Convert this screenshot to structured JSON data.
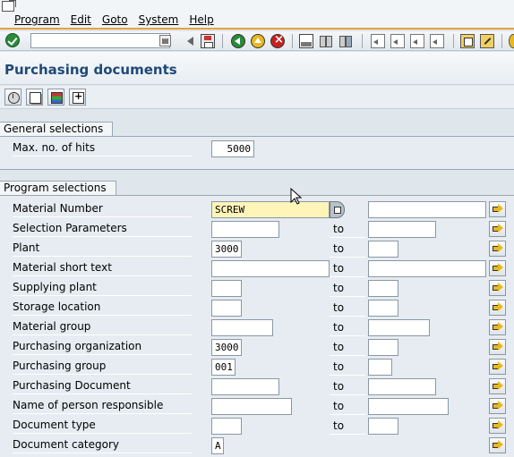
{
  "menubar": {
    "items": [
      "Program",
      "Edit",
      "Goto",
      "System",
      "Help"
    ]
  },
  "toolbar": {
    "command_field_value": "",
    "icons": [
      "ok-icon",
      "back-arrow-icon",
      "save-icon",
      "back-icon",
      "exit-icon",
      "cancel-icon",
      "print-icon",
      "find-icon",
      "find-next-icon",
      "first-page-icon",
      "previous-page-icon",
      "next-page-icon",
      "last-page-icon",
      "new-session-icon",
      "shortcut-icon",
      "help-icon"
    ]
  },
  "page": {
    "title": "Purchasing documents"
  },
  "app_toolbar": {
    "icons": [
      "execute-icon",
      "get-variant-icon",
      "dynamic-selections-icon",
      "selection-options-icon"
    ]
  },
  "general_selections": {
    "title": "General selections",
    "max_hits_label": "Max. no. of hits",
    "max_hits_value": "5000"
  },
  "program_selections": {
    "title": "Program selections",
    "to_label": "to",
    "rows": [
      {
        "label": "Material Number",
        "from": "SCREW",
        "to": ""
      },
      {
        "label": "Selection Parameters",
        "from": "",
        "to": ""
      },
      {
        "label": "Plant",
        "from": "3000",
        "to": ""
      },
      {
        "label": "Material short text",
        "from": "",
        "to": ""
      },
      {
        "label": "Supplying plant",
        "from": "",
        "to": ""
      },
      {
        "label": "Storage location",
        "from": "",
        "to": ""
      },
      {
        "label": "Material group",
        "from": "",
        "to": ""
      },
      {
        "label": "Purchasing organization",
        "from": "3000",
        "to": ""
      },
      {
        "label": "Purchasing group",
        "from": "001",
        "to": ""
      },
      {
        "label": "Purchasing Document",
        "from": "",
        "to": ""
      },
      {
        "label": "Name of person responsible",
        "from": "",
        "to": ""
      },
      {
        "label": "Document type",
        "from": "",
        "to": ""
      },
      {
        "label": "Document category",
        "from": "A",
        "to": ""
      }
    ]
  },
  "colors": {
    "accent": "#e8a040",
    "title": "#1e4a78",
    "background": "#dfe6ec",
    "active_field": "#fff5b8"
  }
}
